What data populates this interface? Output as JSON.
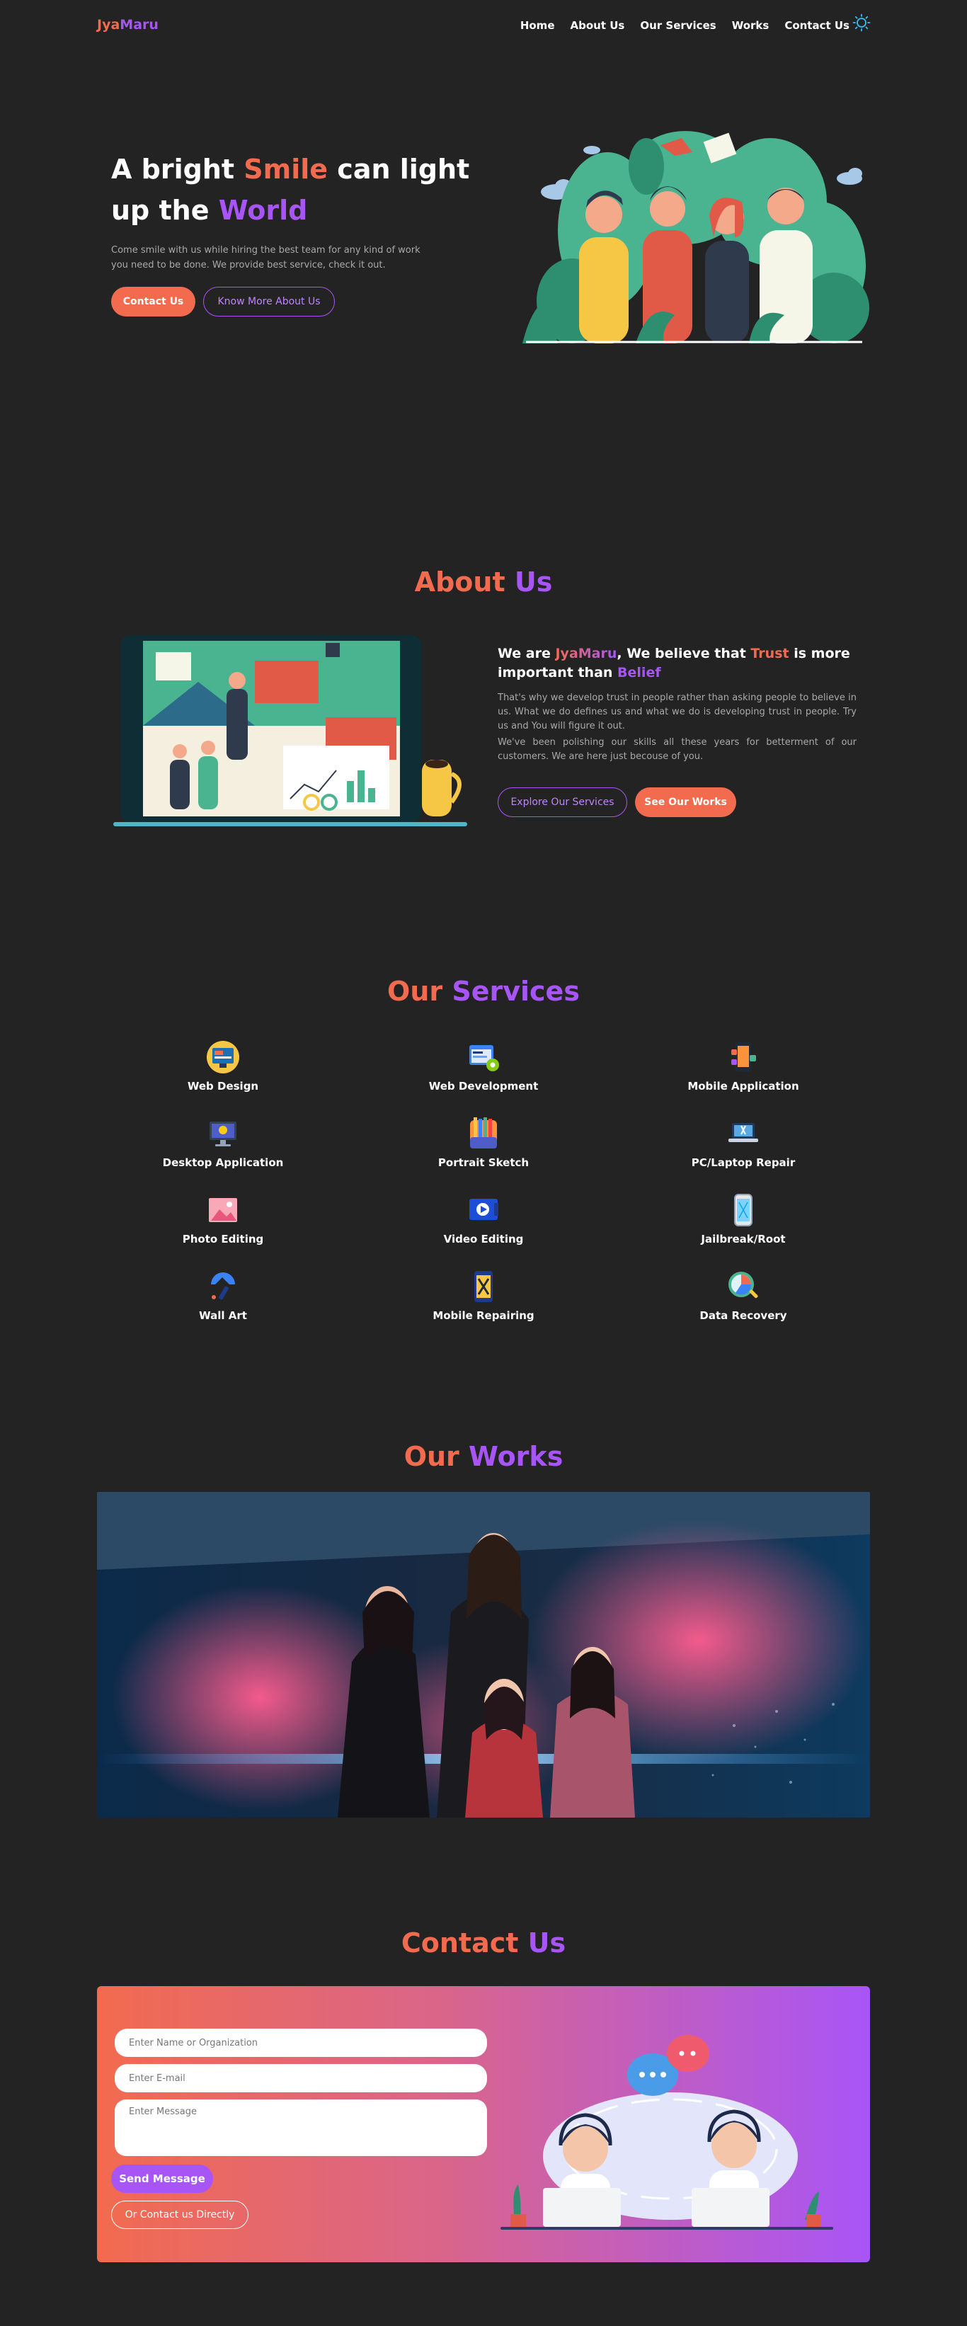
{
  "nav": {
    "logo_part1": "Jya",
    "logo_part2": "Maru",
    "links": [
      "Home",
      "About Us",
      "Our Services",
      "Works",
      "Contact Us"
    ],
    "theme_icon": "sun-icon"
  },
  "hero": {
    "title_part1": "A bright ",
    "title_highlight1": "Smile",
    "title_part2": " can light up the ",
    "title_highlight2": "World",
    "description": "Come smile with us while hiring the best team for any kind of work you need to be done. We provide best service, check it out.",
    "contact_button": "Contact Us",
    "know_more_button": "Know More About Us",
    "illustration": "team-illustration"
  },
  "about": {
    "title_part1": "About ",
    "title_part2": "Us",
    "heading_we_are": "We are ",
    "heading_brand": "JyaMaru",
    "heading_mid": ", We believe that ",
    "heading_trust": "Trust",
    "heading_is_more": " is more important than ",
    "heading_belief": "Belief",
    "paragraph1": "That's why we develop trust in people rather than asking people to believe in us. What we do defines us and what we do is developing trust in people. Try us and You will figure it out.",
    "paragraph2": "We've been polishing our skills all these years for betterment of our customers. We are here just becouse of you.",
    "explore_button": "Explore Our Services",
    "works_button": "See Our Works",
    "illustration": "office-laptop-illustration"
  },
  "services": {
    "title_part1": "Our ",
    "title_part2": "Services",
    "items": [
      {
        "label": "Web Design",
        "icon": "web-design-icon"
      },
      {
        "label": "Web Development",
        "icon": "web-development-icon"
      },
      {
        "label": "Mobile Application",
        "icon": "mobile-app-icon"
      },
      {
        "label": "Desktop Application",
        "icon": "desktop-app-icon"
      },
      {
        "label": "Portrait Sketch",
        "icon": "portrait-sketch-icon"
      },
      {
        "label": "PC/Laptop Repair",
        "icon": "laptop-repair-icon"
      },
      {
        "label": "Photo Editing",
        "icon": "photo-editing-icon"
      },
      {
        "label": "Video Editing",
        "icon": "video-editing-icon"
      },
      {
        "label": "Jailbreak/Root",
        "icon": "jailbreak-icon"
      },
      {
        "label": "Wall Art",
        "icon": "wall-art-icon"
      },
      {
        "label": "Mobile Repairing",
        "icon": "mobile-repair-icon"
      },
      {
        "label": "Data Recovery",
        "icon": "data-recovery-icon"
      }
    ]
  },
  "works": {
    "title_part1": "Our ",
    "title_part2": "Works",
    "image": "works-showcase-photo"
  },
  "contact": {
    "title_part1": "Contact ",
    "title_part2": "Us",
    "name_placeholder": "Enter Name or Organization",
    "email_placeholder": "Enter E-mail",
    "message_placeholder": "Enter Message",
    "send_button": "Send Message",
    "direct_button": "Or Contact us Directly",
    "illustration": "support-agents-illustration"
  },
  "colors": {
    "background": "#232323",
    "accent_orange": "#f26b4f",
    "accent_purple": "#a855f7",
    "muted_text": "#a9a9a9"
  }
}
